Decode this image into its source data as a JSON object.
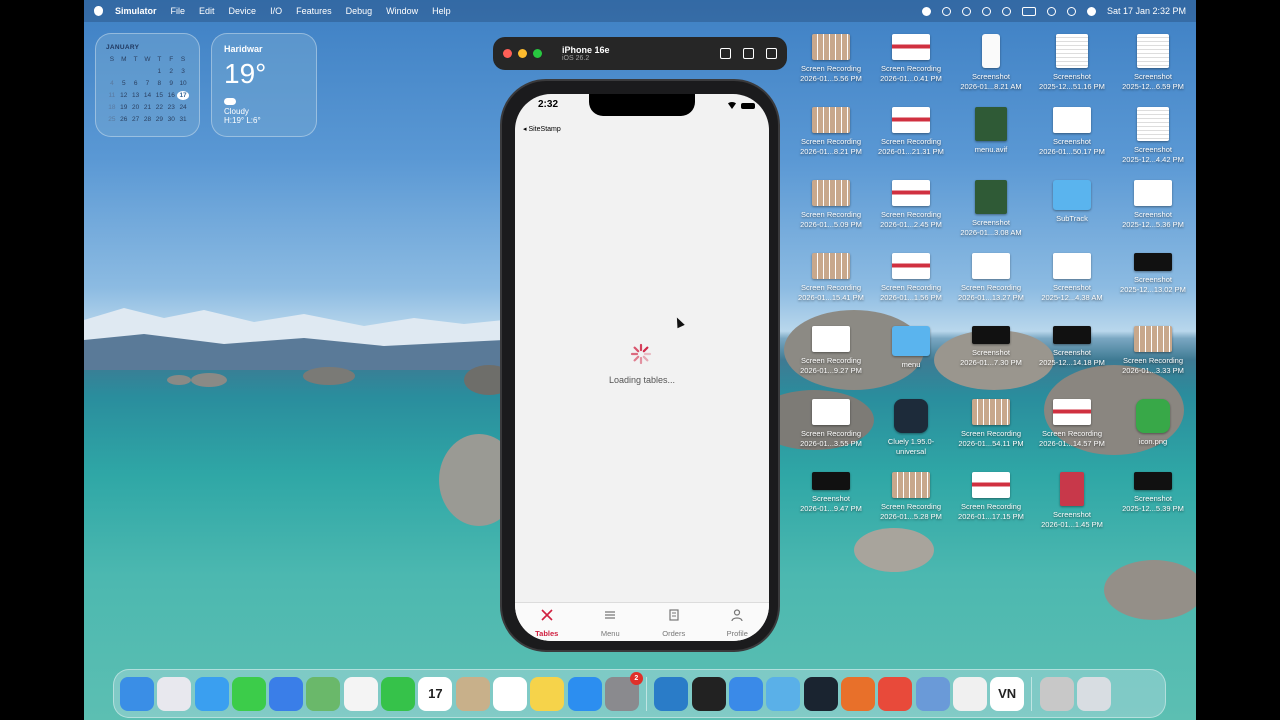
{
  "menubar": {
    "app": "Simulator",
    "items": [
      "File",
      "Edit",
      "Device",
      "I/O",
      "Features",
      "Debug",
      "Window",
      "Help"
    ],
    "datetime": "Sat 17 Jan  2:32 PM"
  },
  "calendar_widget": {
    "month": "JANUARY",
    "weekdays": [
      "S",
      "M",
      "T",
      "W",
      "T",
      "F",
      "S"
    ],
    "rows": [
      [
        "",
        "",
        "",
        "",
        "1",
        "2",
        "3"
      ],
      [
        "4",
        "5",
        "6",
        "7",
        "8",
        "9",
        "10"
      ],
      [
        "11",
        "12",
        "13",
        "14",
        "15",
        "16",
        "17"
      ],
      [
        "18",
        "19",
        "20",
        "21",
        "22",
        "23",
        "24"
      ],
      [
        "25",
        "26",
        "27",
        "28",
        "29",
        "30",
        "31"
      ]
    ],
    "today": "17"
  },
  "weather_widget": {
    "city": "Haridwar",
    "temp": "19°",
    "condition": "Cloudy",
    "high_low": "H:19° L:6°"
  },
  "simulator": {
    "device": "iPhone 16e",
    "os": "iOS 26.2"
  },
  "phone": {
    "time": "2:32",
    "back_label": "◂ SiteStamp",
    "loading_text": "Loading tables...",
    "tabs": [
      {
        "label": "Tables",
        "icon": "utensils-icon",
        "active": true
      },
      {
        "label": "Menu",
        "icon": "menu-icon",
        "active": false
      },
      {
        "label": "Orders",
        "icon": "receipt-icon",
        "active": false
      },
      {
        "label": "Profile",
        "icon": "person-icon",
        "active": false
      }
    ],
    "accent": "#d02040"
  },
  "desktop_icons": [
    {
      "l1": "Screen Recording",
      "l2": "2026-01...5.56 PM",
      "kind": "grid"
    },
    {
      "l1": "Screen Recording",
      "l2": "2026-01...0.41 PM",
      "kind": "red"
    },
    {
      "l1": "Screenshot",
      "l2": "2026-01...8.21 AM",
      "kind": "phone"
    },
    {
      "l1": "Screenshot",
      "l2": "2025-12...51.16 PM",
      "kind": "doc"
    },
    {
      "l1": "Screenshot",
      "l2": "2025-12...6.59 PM",
      "kind": "doc"
    },
    {
      "l1": "Screen Recording",
      "l2": "2026-01...8.21 PM",
      "kind": "grid"
    },
    {
      "l1": "Screen Recording",
      "l2": "2026-01...21.31 PM",
      "kind": "red"
    },
    {
      "l1": "menu.avif",
      "l2": "",
      "kind": "green"
    },
    {
      "l1": "Screenshot",
      "l2": "2026-01...50.17 PM",
      "kind": "plain"
    },
    {
      "l1": "Screenshot",
      "l2": "2025-12...4.42 PM",
      "kind": "doc"
    },
    {
      "l1": "Screen Recording",
      "l2": "2026-01...5.09 PM",
      "kind": "grid"
    },
    {
      "l1": "Screen Recording",
      "l2": "2026-01...2.45 PM",
      "kind": "red"
    },
    {
      "l1": "Screenshot",
      "l2": "2026-01...3.08 AM",
      "kind": "green"
    },
    {
      "l1": "SubTrack",
      "l2": "",
      "kind": "folder"
    },
    {
      "l1": "Screenshot",
      "l2": "2025-12...5.36 PM",
      "kind": "plain"
    },
    {
      "l1": "Screen Recording",
      "l2": "2026-01...15.41 PM",
      "kind": "grid"
    },
    {
      "l1": "Screen Recording",
      "l2": "2026-01...1.56 PM",
      "kind": "red"
    },
    {
      "l1": "Screen Recording",
      "l2": "2026-01...13.27 PM",
      "kind": "plain"
    },
    {
      "l1": "Screenshot",
      "l2": "2025-12...4.38 AM",
      "kind": "plain"
    },
    {
      "l1": "Screenshot",
      "l2": "2025-12...13.02 PM",
      "kind": "dark"
    },
    {
      "l1": "Screen Recording",
      "l2": "2026-01...9.27 PM",
      "kind": "plain"
    },
    {
      "l1": "menu",
      "l2": "",
      "kind": "folder"
    },
    {
      "l1": "Screenshot",
      "l2": "2026-01...7.30 PM",
      "kind": "dark"
    },
    {
      "l1": "Screenshot",
      "l2": "2025-12...14.18 PM",
      "kind": "dark"
    },
    {
      "l1": "Screen Recording",
      "l2": "2026-01...3.33 PM",
      "kind": "grid"
    },
    {
      "l1": "Screen Recording",
      "l2": "2026-01...3.55 PM",
      "kind": "plain"
    },
    {
      "l1": "Cluely 1.95.0-",
      "l2": "universal",
      "kind": "app"
    },
    {
      "l1": "Screen Recording",
      "l2": "2026-01...54.11 PM",
      "kind": "grid"
    },
    {
      "l1": "Screen Recording",
      "l2": "2026-01...14.57 PM",
      "kind": "red"
    },
    {
      "l1": "icon.png",
      "l2": "",
      "kind": "appg"
    },
    {
      "l1": "Screenshot",
      "l2": "2026-01...9.47 PM",
      "kind": "dark"
    },
    {
      "l1": "Screen Recording",
      "l2": "2026-01...5.28 PM",
      "kind": "grid"
    },
    {
      "l1": "Screen Recording",
      "l2": "2026-01...17.15 PM",
      "kind": "red"
    },
    {
      "l1": "Screenshot",
      "l2": "2026-01...1.45 PM",
      "kind": "pink"
    },
    {
      "l1": "Screenshot",
      "l2": "2025-12...5.39 PM",
      "kind": "dark"
    }
  ],
  "dock": {
    "apps": [
      {
        "name": "finder-icon",
        "color": "#3a8ee6"
      },
      {
        "name": "launchpad-icon",
        "color": "#e8e8ee"
      },
      {
        "name": "safari-icon",
        "color": "#3a9ff0"
      },
      {
        "name": "messages-icon",
        "color": "#3ccc4a"
      },
      {
        "name": "mail-icon",
        "color": "#3a7ee8"
      },
      {
        "name": "maps-icon",
        "color": "#6ab86a"
      },
      {
        "name": "photos-icon",
        "color": "#f4f4f4"
      },
      {
        "name": "facetime-icon",
        "color": "#36c24a"
      },
      {
        "name": "calendar-icon",
        "color": "#ffffff",
        "label": "17"
      },
      {
        "name": "contacts-icon",
        "color": "#c8b08a"
      },
      {
        "name": "reminders-icon",
        "color": "#ffffff"
      },
      {
        "name": "notes-icon",
        "color": "#f6d34a"
      },
      {
        "name": "app-store-icon",
        "color": "#2c8ef0"
      },
      {
        "name": "system-settings-icon",
        "color": "#8a8a8e",
        "badge": "2"
      },
      {
        "sep": true
      },
      {
        "name": "vscode-icon",
        "color": "#2a7cc8"
      },
      {
        "name": "unity-icon",
        "color": "#222222"
      },
      {
        "name": "xcode-icon",
        "color": "#3a8ae8"
      },
      {
        "name": "files-icon",
        "color": "#5ab0e8"
      },
      {
        "name": "cluely-icon",
        "color": "#1a2430"
      },
      {
        "name": "firefox-icon",
        "color": "#e8702a"
      },
      {
        "name": "spark-icon",
        "color": "#e84a3a"
      },
      {
        "name": "simulator-icon",
        "color": "#6a9ad8"
      },
      {
        "name": "chrome-icon",
        "color": "#f0f0f0"
      },
      {
        "name": "vn-icon",
        "color": "#ffffff",
        "label": "VN"
      },
      {
        "sep": true
      },
      {
        "name": "downloads-stack-icon",
        "color": "#c8c8c8"
      },
      {
        "name": "trash-icon",
        "color": "#d8dde2"
      }
    ]
  }
}
